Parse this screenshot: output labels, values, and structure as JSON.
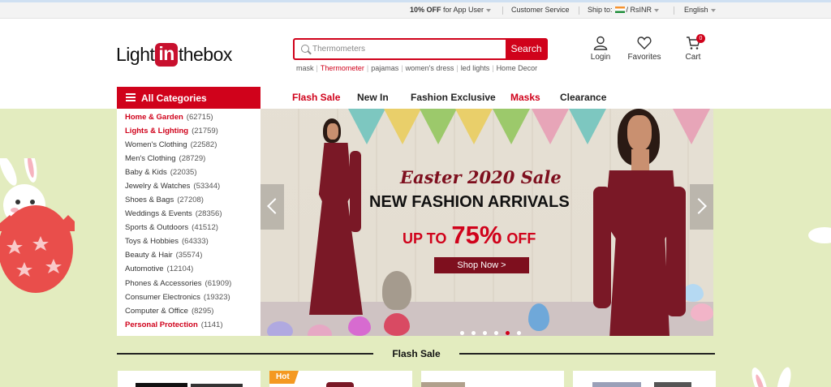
{
  "topbar": {
    "promo_bold": "10% OFF",
    "promo_rest": "for App User",
    "customer_service": "Customer Service",
    "ship_to_label": "Ship to:",
    "currency": "RsINR",
    "language": "English"
  },
  "header": {
    "logo_left": "Light",
    "logo_in": "in",
    "logo_right": "thebox",
    "search_placeholder": "Thermometers",
    "search_button": "Search",
    "hot_words": [
      "mask",
      "Thermometer",
      "pajamas",
      "women's dress",
      "led lights",
      "Home Decor"
    ],
    "login": "Login",
    "favorites": "Favorites",
    "cart": "Cart",
    "cart_count": "0"
  },
  "nav": {
    "all_categories": "All Categories",
    "items": [
      "Flash Sale",
      "New In",
      "Fashion Exclusive",
      "Masks",
      "Clearance"
    ]
  },
  "categories": [
    {
      "name": "Home & Garden",
      "count": "(62715)"
    },
    {
      "name": "Lights & Lighting",
      "count": "(21759)"
    },
    {
      "name": "Women's Clothing",
      "count": "(22582)"
    },
    {
      "name": "Men's Clothing",
      "count": "(28729)"
    },
    {
      "name": "Baby & Kids",
      "count": "(22035)"
    },
    {
      "name": "Jewelry & Watches",
      "count": "(53344)"
    },
    {
      "name": "Shoes & Bags",
      "count": "(27208)"
    },
    {
      "name": "Weddings & Events",
      "count": "(28356)"
    },
    {
      "name": "Sports & Outdoors",
      "count": "(41512)"
    },
    {
      "name": "Toys & Hobbies",
      "count": "(64333)"
    },
    {
      "name": "Beauty & Hair",
      "count": "(35574)"
    },
    {
      "name": "Automotive",
      "count": "(12104)"
    },
    {
      "name": "Phones & Accessories",
      "count": "(61909)"
    },
    {
      "name": "Consumer Electronics",
      "count": "(19323)"
    },
    {
      "name": "Computer & Office",
      "count": "(8295)"
    },
    {
      "name": "Personal Protection",
      "count": "(1141)"
    }
  ],
  "banner": {
    "script_title": "Easter 2020 Sale",
    "headline": "NEW FASHION ARRIVALS",
    "sale_prefix": "UP TO",
    "sale_percent": "75%",
    "sale_suffix": "OFF",
    "cta": "Shop Now >",
    "active_slide": 4,
    "slide_count": 6
  },
  "flash_sale": {
    "title": "Flash Sale",
    "hot_badge": "Hot"
  },
  "colors": {
    "brand_red": "#d0021b",
    "hero_background": "#e3ecbf",
    "dress": "#7a1826",
    "hot_badge": "#f49922"
  }
}
